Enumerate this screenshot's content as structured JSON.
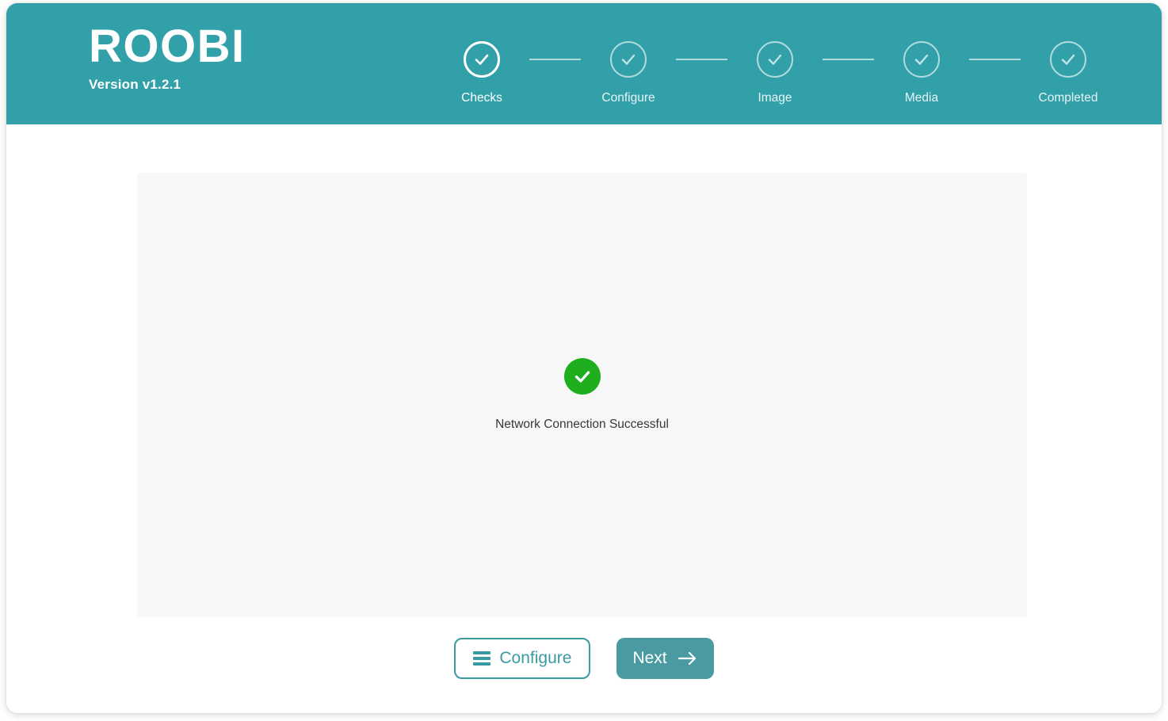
{
  "app": {
    "brand": "ROOBI",
    "version": "Version v1.2.1",
    "accent_color": "#31a0a8",
    "success_color": "#1eae1e",
    "panel_color": "#f7f7f7"
  },
  "stepper": {
    "steps": [
      {
        "label": "Checks",
        "state": "active",
        "icon": "check-circle-icon"
      },
      {
        "label": "Configure",
        "state": "inactive",
        "icon": "check-circle-icon"
      },
      {
        "label": "Image",
        "state": "inactive",
        "icon": "check-circle-icon"
      },
      {
        "label": "Media",
        "state": "inactive",
        "icon": "check-circle-icon"
      },
      {
        "label": "Completed",
        "state": "inactive",
        "icon": "check-circle-icon"
      }
    ]
  },
  "content": {
    "status_icon": "success-check-icon",
    "status_text": "Network Connection Successful"
  },
  "footer": {
    "configure_label": "Configure",
    "configure_icon": "hamburger-menu-icon",
    "next_label": "Next",
    "next_icon": "arrow-right-icon"
  }
}
